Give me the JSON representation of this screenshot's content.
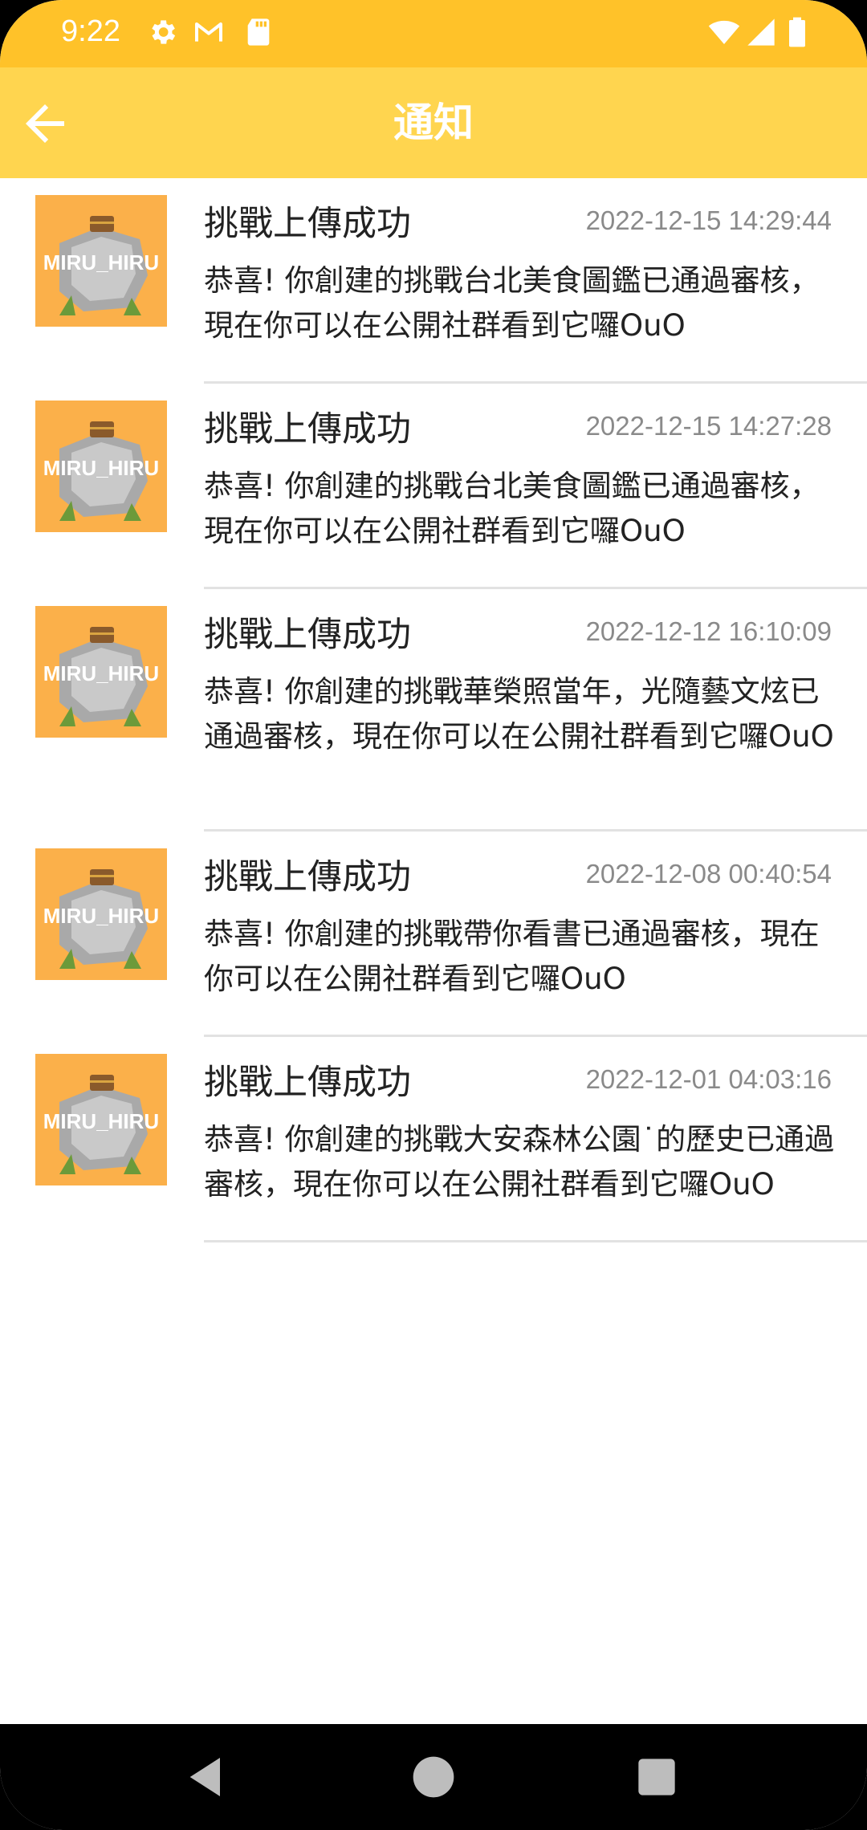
{
  "status_bar": {
    "time": "9:22",
    "left_icons": [
      "gear-icon",
      "gmail-icon",
      "sd-card-icon"
    ],
    "right_icons": [
      "wifi-icon",
      "signal-icon",
      "battery-icon"
    ]
  },
  "app_bar": {
    "title": "通知",
    "back_icon": "arrow-left-icon",
    "color": "#FFD54F"
  },
  "avatar": {
    "text": "MIRU_HIRU",
    "background": "#FBB04A"
  },
  "notifications": [
    {
      "title": "挑戰上傳成功",
      "time": "2022-12-15 14:29:44",
      "body": "恭喜! 你創建的挑戰台北美食圖鑑已通過審核，現在你可以在公開社群看到它囉OuO"
    },
    {
      "title": "挑戰上傳成功",
      "time": "2022-12-15 14:27:28",
      "body": "恭喜! 你創建的挑戰台北美食圖鑑已通過審核，現在你可以在公開社群看到它囉OuO"
    },
    {
      "title": "挑戰上傳成功",
      "time": "2022-12-12 16:10:09",
      "body": "恭喜! 你創建的挑戰華榮照當年，光隨藝文炫已通過審核，現在你可以在公開社群看到它囉OuO"
    },
    {
      "title": "挑戰上傳成功",
      "time": "2022-12-08 00:40:54",
      "body": "恭喜! 你創建的挑戰帶你看書已通過審核，現在你可以在公開社群看到它囉OuO"
    },
    {
      "title": "挑戰上傳成功",
      "time": "2022-12-01 04:03:16",
      "body": "恭喜! 你創建的挑戰大安森林公園˙的歷史已通過審核，現在你可以在公開社群看到它囉OuO"
    }
  ],
  "nav_bar": {
    "icons": [
      "back-triangle-icon",
      "home-circle-icon",
      "recents-square-icon"
    ]
  }
}
